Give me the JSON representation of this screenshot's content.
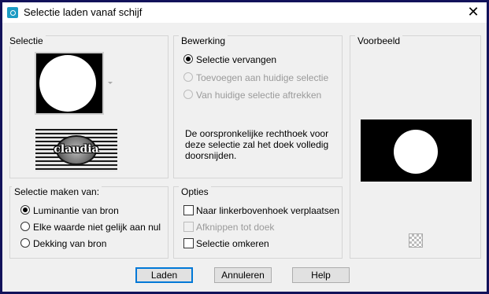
{
  "window": {
    "title": "Selectie laden vanaf schijf",
    "close": "✕"
  },
  "selectie": {
    "title": "Selectie",
    "logo_text": "claudia"
  },
  "bewerking": {
    "title": "Bewerking",
    "options": [
      "Selectie vervangen",
      "Toevoegen aan huidige selectie",
      "Van huidige selectie aftrekken"
    ],
    "selected": 0,
    "description_lines": [
      "De oorspronkelijke rechthoek voor",
      "deze selectie zal het doek volledig",
      "doorsnijden."
    ]
  },
  "voorbeeld": {
    "title": "Voorbeeld"
  },
  "maken_van": {
    "title": "Selectie maken van:",
    "options": [
      "Luminantie van bron",
      "Elke waarde niet gelijk aan nul",
      "Dekking van bron"
    ],
    "selected": 0
  },
  "opties": {
    "title": "Opties",
    "items": [
      {
        "label": "Naar linkerbovenhoek verplaatsen",
        "checked": false,
        "enabled": true
      },
      {
        "label": "Afknippen tot doek",
        "checked": false,
        "enabled": false
      },
      {
        "label": "Selectie omkeren",
        "checked": false,
        "enabled": true
      }
    ]
  },
  "buttons": {
    "ok": "Laden",
    "cancel": "Annuleren",
    "help": "Help"
  }
}
